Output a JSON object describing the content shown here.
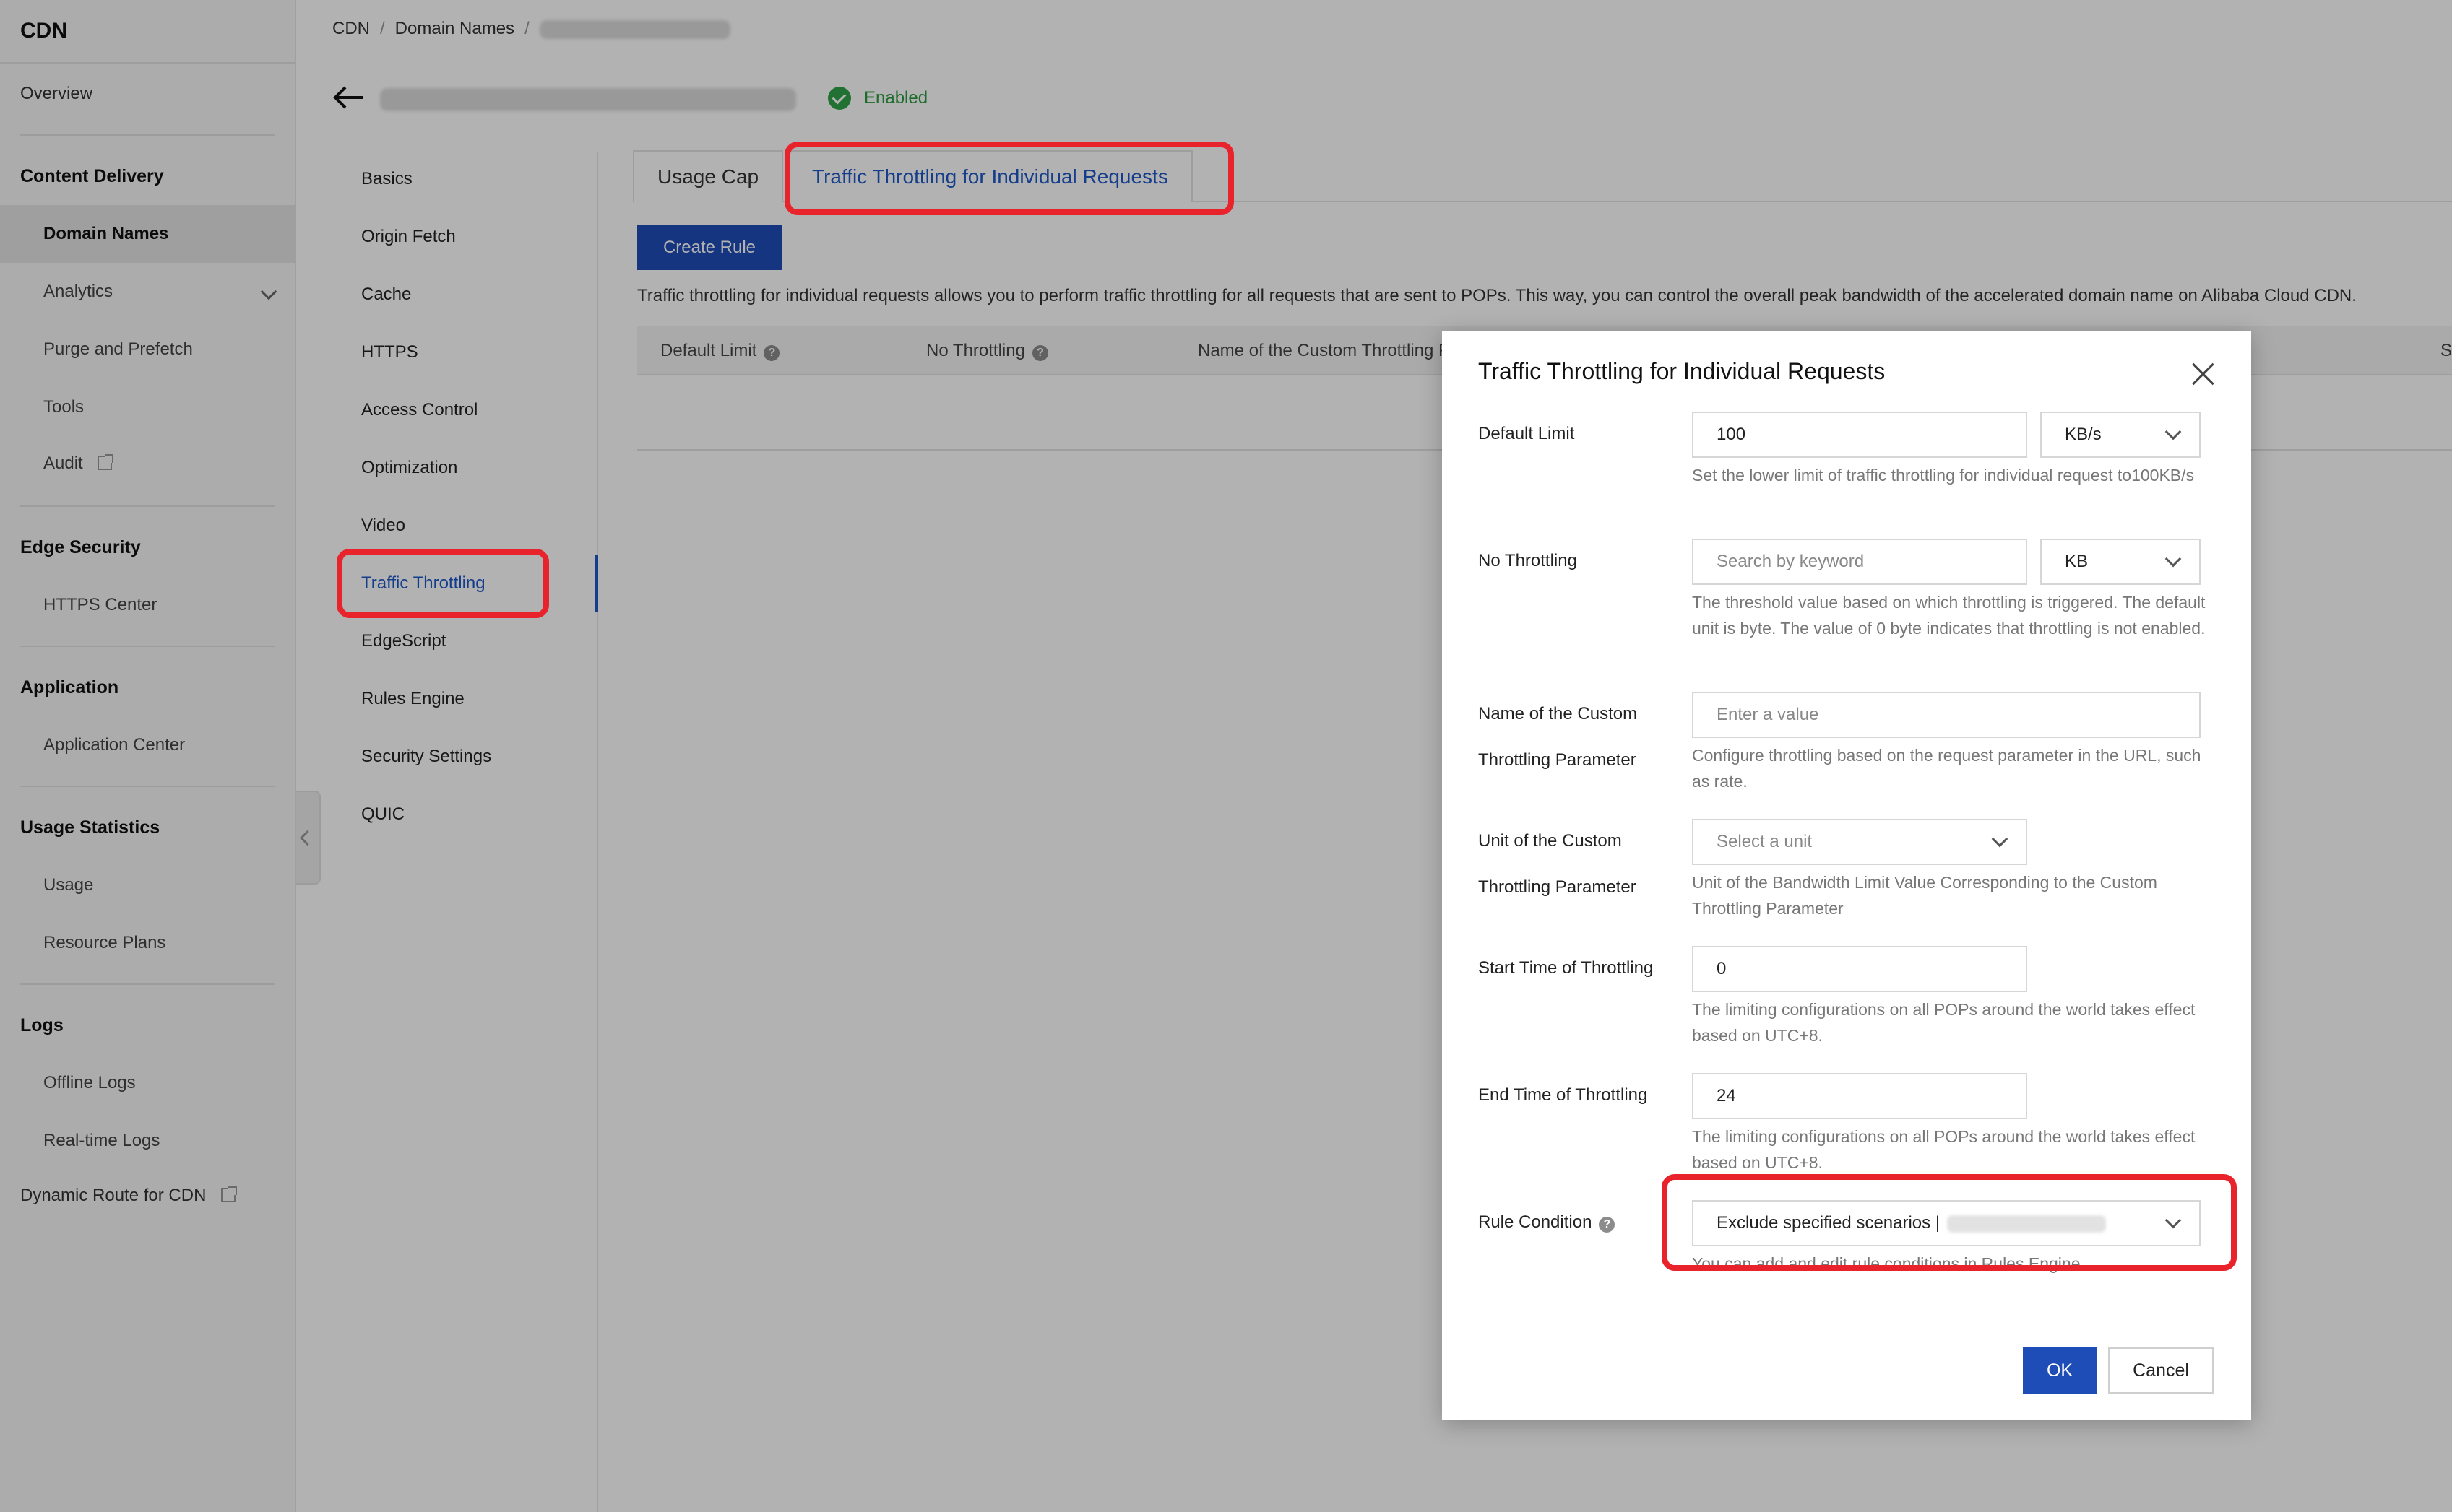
{
  "sidebar": {
    "brand": "CDN",
    "overview": "Overview",
    "groups": {
      "content_delivery": "Content Delivery",
      "edge_security": "Edge Security",
      "application": "Application",
      "usage_statistics": "Usage Statistics",
      "logs": "Logs"
    },
    "items": {
      "domain_names": "Domain Names",
      "analytics": "Analytics",
      "purge_prefetch": "Purge and Prefetch",
      "tools": "Tools",
      "audit": "Audit",
      "https_center": "HTTPS Center",
      "application_center": "Application Center",
      "usage": "Usage",
      "resource_plans": "Resource Plans",
      "offline_logs": "Offline Logs",
      "realtime_logs": "Real-time Logs"
    },
    "dynamic_route": "Dynamic Route for CDN"
  },
  "breadcrumb": {
    "root": "CDN",
    "section": "Domain Names",
    "sep": "/"
  },
  "domain": {
    "status": "Enabled"
  },
  "subnav": {
    "basics": "Basics",
    "origin_fetch": "Origin Fetch",
    "cache": "Cache",
    "https": "HTTPS",
    "access_control": "Access Control",
    "optimization": "Optimization",
    "video": "Video",
    "traffic_throttling": "Traffic Throttling",
    "edgescript": "EdgeScript",
    "rules_engine": "Rules Engine",
    "security_settings": "Security Settings",
    "quic": "QUIC"
  },
  "tabs": {
    "usage_cap": "Usage Cap",
    "individual_requests": "Traffic Throttling for Individual Requests"
  },
  "main": {
    "create_rule": "Create Rule",
    "description": "Traffic throttling for individual requests allows you to perform traffic throttling for all requests that are sent to POPs. This way, you can control the overall peak bandwidth of the accelerated domain name on Alibaba Cloud CDN.",
    "columns": {
      "default_limit": "Default Limit",
      "no_throttling": "No Throttling",
      "custom_param": "Name of the Custom Throttling Parameter",
      "last_col": "S"
    }
  },
  "dialog": {
    "title": "Traffic Throttling for Individual Requests",
    "default_limit": {
      "label": "Default Limit",
      "value": "100",
      "unit": "KB/s",
      "hint": "Set the lower limit of traffic throttling for individual request to100KB/s"
    },
    "no_throttling": {
      "label": "No Throttling",
      "placeholder": "Search by keyword",
      "unit": "KB",
      "hint": "The threshold value based on which throttling is triggered. The default unit is byte. The value of 0 byte indicates that throttling is not enabled."
    },
    "custom_param_name": {
      "label_line1": "Name of the Custom",
      "label_line2": "Throttling Parameter",
      "placeholder": "Enter a value",
      "hint": "Configure throttling based on the request parameter in the URL, such as rate."
    },
    "custom_param_unit": {
      "label_line1": "Unit of the Custom",
      "label_line2": "Throttling Parameter",
      "placeholder": "Select a unit",
      "hint": "Unit of the Bandwidth Limit Value Corresponding to the Custom Throttling Parameter"
    },
    "start_time": {
      "label": "Start Time of Throttling",
      "value": "0",
      "hint": "The limiting configurations on all POPs around the world takes effect based on UTC+8."
    },
    "end_time": {
      "label": "End Time of Throttling",
      "value": "24",
      "hint": "The limiting configurations on all POPs around the world takes effect based on UTC+8."
    },
    "rule_condition": {
      "label": "Rule Condition",
      "value": "Exclude specified scenarios |",
      "hint": "You can add and edit rule conditions in Rules Engine."
    },
    "ok": "OK",
    "cancel": "Cancel"
  },
  "colors": {
    "primary": "#1f4db8",
    "link": "#1d58c7",
    "success": "#30a34a",
    "callout": "#e8232b"
  },
  "icons": [
    "back-arrow-icon",
    "check-circle-icon",
    "chevron-down-icon",
    "external-link-icon",
    "help-icon",
    "close-icon",
    "collapse-icon"
  ]
}
